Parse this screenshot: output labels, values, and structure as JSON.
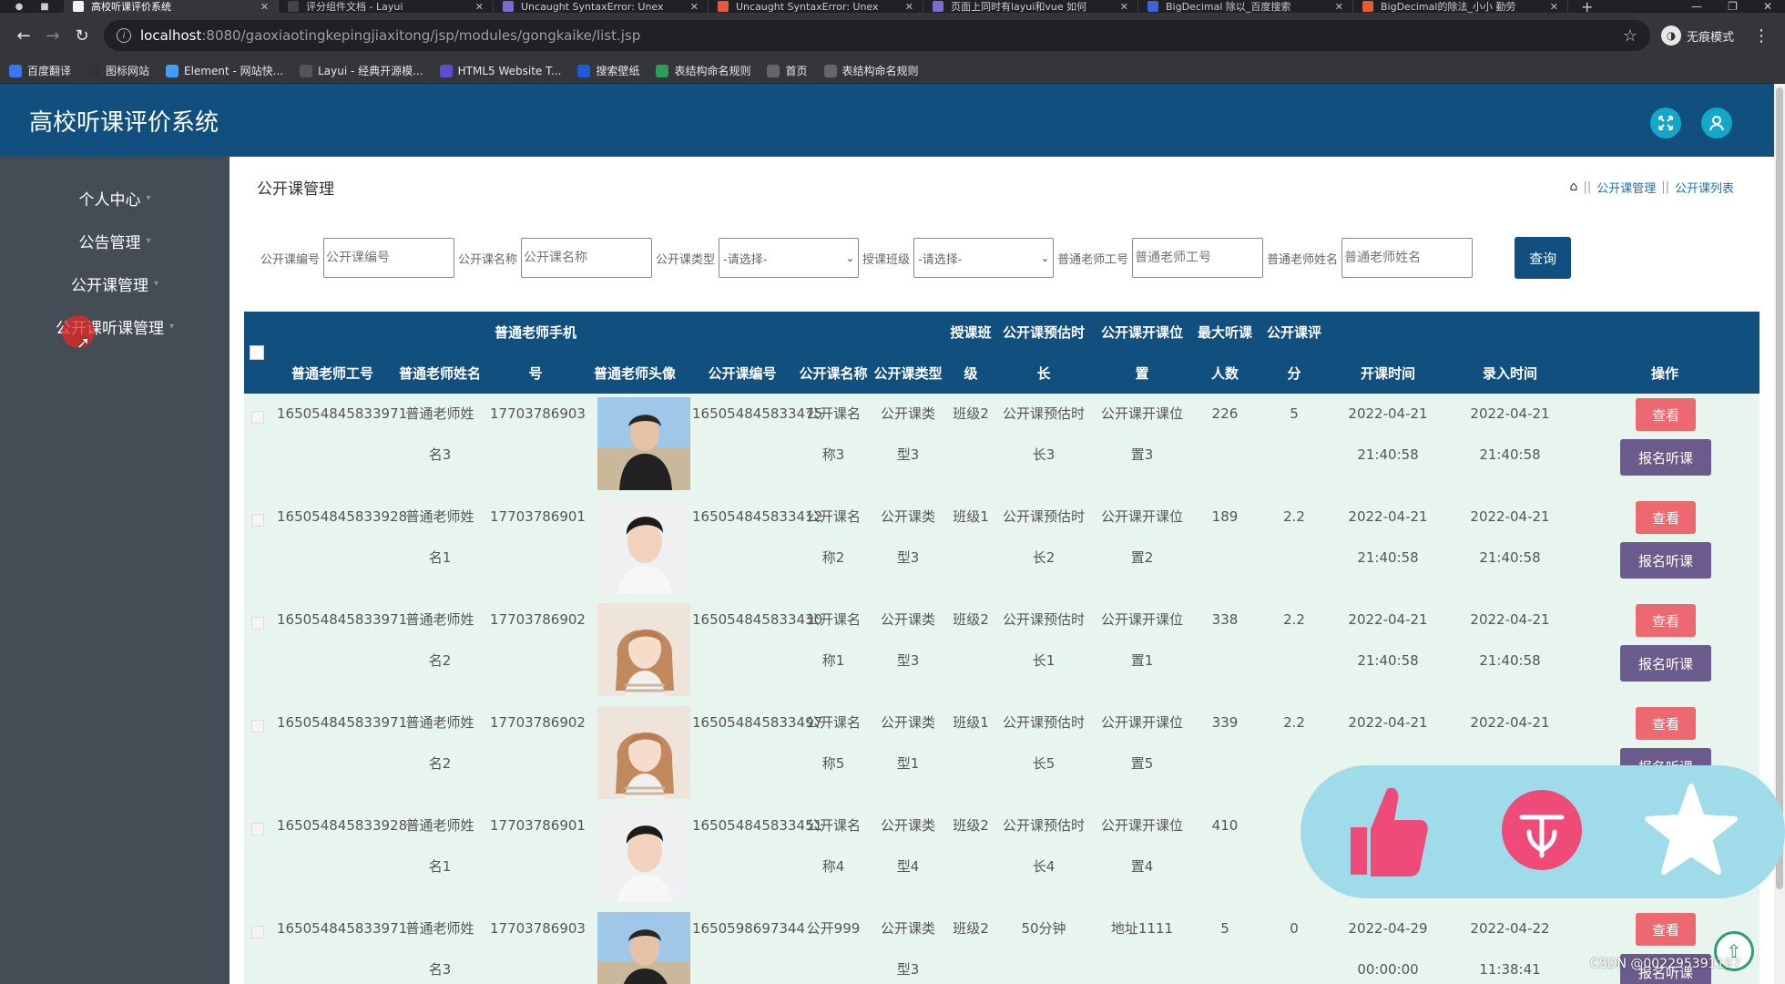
{
  "browser": {
    "tabs": [
      {
        "title": "高校听课评价系统",
        "color": "#f5f5f5",
        "active": true
      },
      {
        "title": "评分组件文档 - Layui",
        "color": "#444444"
      },
      {
        "title": "Uncaught SyntaxError: Unex",
        "color": "#7a6bd1"
      },
      {
        "title": "Uncaught SyntaxError: Unex",
        "color": "#e25c3a"
      },
      {
        "title": "页面上同时有layui和vue 如何",
        "color": "#7a6bd1"
      },
      {
        "title": "BigDecimal 除以_百度搜索",
        "color": "#4062d8"
      },
      {
        "title": "BigDecimal的除法_小小 勤劳",
        "color": "#e25c3a"
      }
    ],
    "url_host": "localhost",
    "url_path": ":8080/gaoxiaotingkepingjiaxitong/jsp/modules/gongkaike/list.jsp",
    "incognito_label": "无痕模式",
    "bookmarks": [
      {
        "label": "百度翻译",
        "color": "#3478f6"
      },
      {
        "label": "图标网站",
        "color": "#333333"
      },
      {
        "label": "Element - 网站快...",
        "color": "#409eff"
      },
      {
        "label": "Layui - 经典开源模...",
        "color": "#555555"
      },
      {
        "label": "HTML5 Website T...",
        "color": "#5b4fcf"
      },
      {
        "label": "搜索壁纸",
        "color": "#1e5bd8"
      },
      {
        "label": "表结构命名规则",
        "color": "#2a9d56"
      },
      {
        "label": "首页",
        "color": "#666666"
      },
      {
        "label": "表结构命名规则",
        "color": "#666666"
      }
    ]
  },
  "app": {
    "title": "高校听课评价系统",
    "colors": {
      "header": "#114f7e",
      "sidebar": "#444d55",
      "row_bg": "#e8f4ee",
      "view_btn": "#ec6a6f",
      "enroll_btn": "#6b5a8c"
    }
  },
  "sidebar": {
    "items": [
      {
        "label": "个人中心"
      },
      {
        "label": "公告管理"
      },
      {
        "label": "公开课管理"
      },
      {
        "label": "公开课听课管理"
      }
    ]
  },
  "page": {
    "title": "公开课管理",
    "breadcrumb": [
      "公开课管理",
      "公开课列表"
    ]
  },
  "filters": {
    "code_label": "公开课编号",
    "code_placeholder": "公开课编号",
    "name_label": "公开课名称",
    "name_placeholder": "公开课名称",
    "type_label": "公开课类型",
    "type_value": "-请选择-",
    "class_label": "授课班级",
    "class_value": "-请选择-",
    "tid_label": "普通老师工号",
    "tid_placeholder": "普通老师工号",
    "tname_label": "普通老师姓名",
    "tname_placeholder": "普通老师姓名",
    "search_label": "查询"
  },
  "table": {
    "headers": {
      "tid": "普通老师工号",
      "tname": "普通老师姓名",
      "phone_top": "普通老师手机",
      "phone_bot": "号",
      "avatar": "普通老师头像",
      "code": "公开课编号",
      "name": "公开课名称",
      "type": "公开课类型",
      "class_top": "授课班",
      "class_bot": "级",
      "dur_top": "公开课预估时",
      "dur_bot": "长",
      "loc_top": "公开课开课位",
      "loc_bot": "置",
      "max_top": "最大听课",
      "max_bot": "人数",
      "score_top": "公开课评",
      "score_bot": "分",
      "start": "开课时间",
      "entry": "录入时间",
      "ops": "操作"
    },
    "view_label": "查看",
    "enroll_label": "报名听课",
    "rows": [
      {
        "tid": "165054845833971",
        "tname1": "普通老师姓",
        "tname2": "名3",
        "phone": "17703786903",
        "avatar": "male-beach",
        "code": "165054845833475",
        "name1": "公开课名",
        "name2": "称3",
        "type1": "公开课类",
        "type2": "型3",
        "class": "班级2",
        "dur1": "公开课预估时",
        "dur2": "长3",
        "loc1": "公开课开课位",
        "loc2": "置3",
        "max": "226",
        "score": "5",
        "start1": "2022-04-21",
        "start2": "21:40:58",
        "entry1": "2022-04-21",
        "entry2": "21:40:58"
      },
      {
        "tid": "165054845833928",
        "tname1": "普通老师姓",
        "tname2": "名1",
        "phone": "17703786901",
        "avatar": "male-studio",
        "code": "165054845833412",
        "name1": "公开课名",
        "name2": "称2",
        "type1": "公开课类",
        "type2": "型3",
        "class": "班级1",
        "dur1": "公开课预估时",
        "dur2": "长2",
        "loc1": "公开课开课位",
        "loc2": "置2",
        "max": "189",
        "score": "2.2",
        "start1": "2022-04-21",
        "start2": "21:40:58",
        "entry1": "2022-04-21",
        "entry2": "21:40:58"
      },
      {
        "tid": "165054845833971",
        "tname1": "普通老师姓",
        "tname2": "名2",
        "phone": "17703786902",
        "avatar": "female-illustration",
        "code": "165054845833430",
        "name1": "公开课名",
        "name2": "称1",
        "type1": "公开课类",
        "type2": "型3",
        "class": "班级2",
        "dur1": "公开课预估时",
        "dur2": "长1",
        "loc1": "公开课开课位",
        "loc2": "置1",
        "max": "338",
        "score": "2.2",
        "start1": "2022-04-21",
        "start2": "21:40:58",
        "entry1": "2022-04-21",
        "entry2": "21:40:58"
      },
      {
        "tid": "165054845833971",
        "tname1": "普通老师姓",
        "tname2": "名2",
        "phone": "17703786902",
        "avatar": "female-illustration",
        "code": "165054845833497",
        "name1": "公开课名",
        "name2": "称5",
        "type1": "公开课类",
        "type2": "型1",
        "class": "班级1",
        "dur1": "公开课预估时",
        "dur2": "长5",
        "loc1": "公开课开课位",
        "loc2": "置5",
        "max": "339",
        "score": "2.2",
        "start1": "2022-04-21",
        "start2": "",
        "entry1": "2022-04-21",
        "entry2": ""
      },
      {
        "tid": "165054845833928",
        "tname1": "普通老师姓",
        "tname2": "名1",
        "phone": "17703786901",
        "avatar": "male-studio",
        "code": "165054845833451",
        "name1": "公开课名",
        "name2": "称4",
        "type1": "公开课类",
        "type2": "型4",
        "class": "班级2",
        "dur1": "公开课预估时",
        "dur2": "长4",
        "loc1": "公开课开课位",
        "loc2": "置4",
        "max": "410",
        "score": "",
        "start1": "",
        "start2": "",
        "entry1": "",
        "entry2": ""
      },
      {
        "tid": "165054845833971",
        "tname1": "普通老师姓",
        "tname2": "名3",
        "phone": "17703786903",
        "avatar": "male-beach",
        "code": "1650598697344",
        "name1": "公开999",
        "name2": "",
        "type1": "公开课类",
        "type2": "型3",
        "class": "班级2",
        "dur1": "50分钟",
        "dur2": "",
        "loc1": "地址1111",
        "loc2": "",
        "max": "5",
        "score": "0",
        "start1": "2022-04-29",
        "start2": "00:00:00",
        "entry1": "2022-04-22",
        "entry2": "11:38:41"
      }
    ]
  },
  "overlay": {
    "icons": [
      "thumbs-up-icon",
      "coin-icon",
      "star-icon"
    ],
    "watermark": "CSDN @002295391197"
  }
}
